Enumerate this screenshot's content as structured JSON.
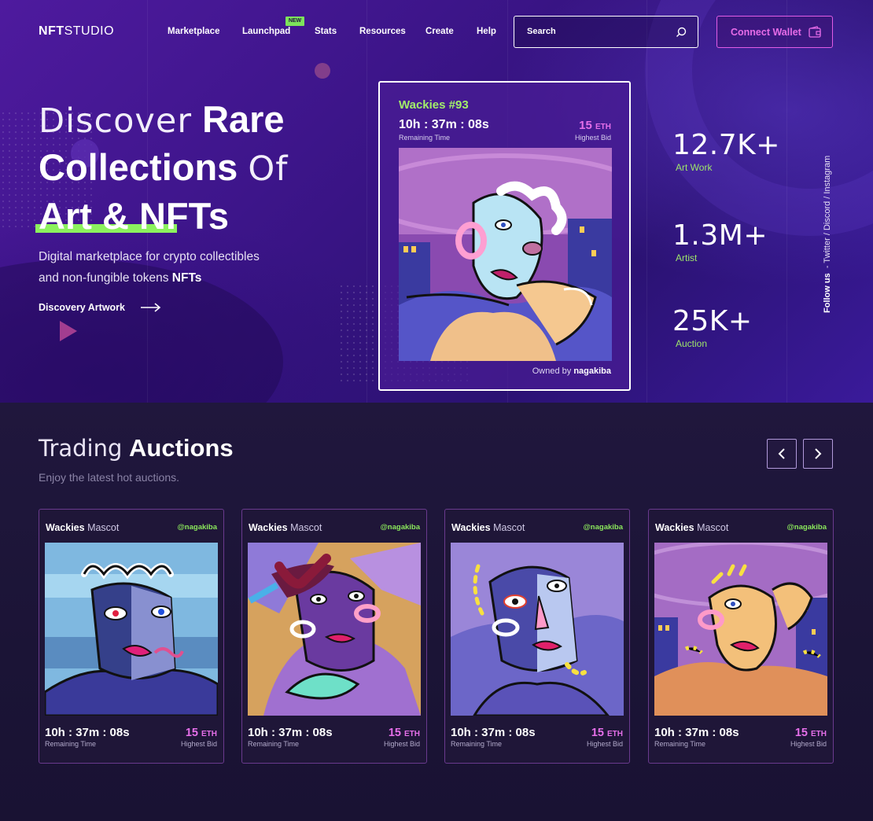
{
  "brand": {
    "bold": "NFT",
    "regular": "STUDIO"
  },
  "nav": {
    "items": [
      {
        "label": "Marketplace"
      },
      {
        "label": "Launchpad"
      },
      {
        "label": "Stats"
      },
      {
        "label": "Resources"
      },
      {
        "label": "Create"
      },
      {
        "label": "Help"
      }
    ],
    "new_badge": "NEW"
  },
  "search": {
    "placeholder": "Search",
    "icon": "search-icon"
  },
  "connect_wallet": {
    "label": "Connect Wallet",
    "icon": "wallet-icon"
  },
  "hero": {
    "line1_thin": "Discover",
    "line1_bold": "Rare",
    "line2_bold": "Collections",
    "line2_thin": "Of",
    "line3_bold": "Art & NFTs",
    "sub_line1": "Digital marketplace for crypto collectibles",
    "sub_line2": "and non-fungible tokens",
    "sub_bold": "NFTs",
    "cta": "Discovery Artwork",
    "accent_color": "#8cf25e"
  },
  "featured": {
    "title": "Wackies #93",
    "time": "10h : 37m : 08s",
    "time_label": "Remaining Time",
    "bid_value": "15",
    "bid_unit": "ETH",
    "bid_label": "Highest Bid",
    "owner_prefix": "Owned by",
    "owner": "nagakiba"
  },
  "stats": [
    {
      "value": "12.7K+",
      "label": "Art Work"
    },
    {
      "value": "1.3M+",
      "label": "Artist"
    },
    {
      "value": "25K+",
      "label": "Auction"
    }
  ],
  "follow": {
    "prefix": "Follow us",
    "links": "-  Twitter  /  Discord  /  Instagram"
  },
  "auctions": {
    "title_thin": "Trading",
    "title_bold": "Auctions",
    "subtitle": "Enjoy the latest hot auctions.",
    "prev_icon": "chevron-left-icon",
    "next_icon": "chevron-right-icon",
    "cards": [
      {
        "name_bold": "Wackies",
        "name": "Mascot",
        "handle": "@nagakiba",
        "time": "10h : 37m : 08s",
        "time_label": "Remaining Time",
        "bid_value": "15",
        "bid_unit": "ETH",
        "bid_label": "Highest Bid"
      },
      {
        "name_bold": "Wackies",
        "name": "Mascot",
        "handle": "@nagakiba",
        "time": "10h : 37m : 08s",
        "time_label": "Remaining Time",
        "bid_value": "15",
        "bid_unit": "ETH",
        "bid_label": "Highest Bid"
      },
      {
        "name_bold": "Wackies",
        "name": "Mascot",
        "handle": "@nagakiba",
        "time": "10h : 37m : 08s",
        "time_label": "Remaining Time",
        "bid_value": "15",
        "bid_unit": "ETH",
        "bid_label": "Highest Bid"
      },
      {
        "name_bold": "Wackies",
        "name": "Mascot",
        "handle": "@nagakiba",
        "time": "10h : 37m : 08s",
        "time_label": "Remaining Time",
        "bid_value": "15",
        "bid_unit": "ETH",
        "bid_label": "Highest Bid"
      }
    ]
  },
  "colors": {
    "accent_green": "#8cf25e",
    "accent_pink": "#e56fe9",
    "hero_bg": "#3d158a",
    "section_bg": "#1b1436"
  }
}
